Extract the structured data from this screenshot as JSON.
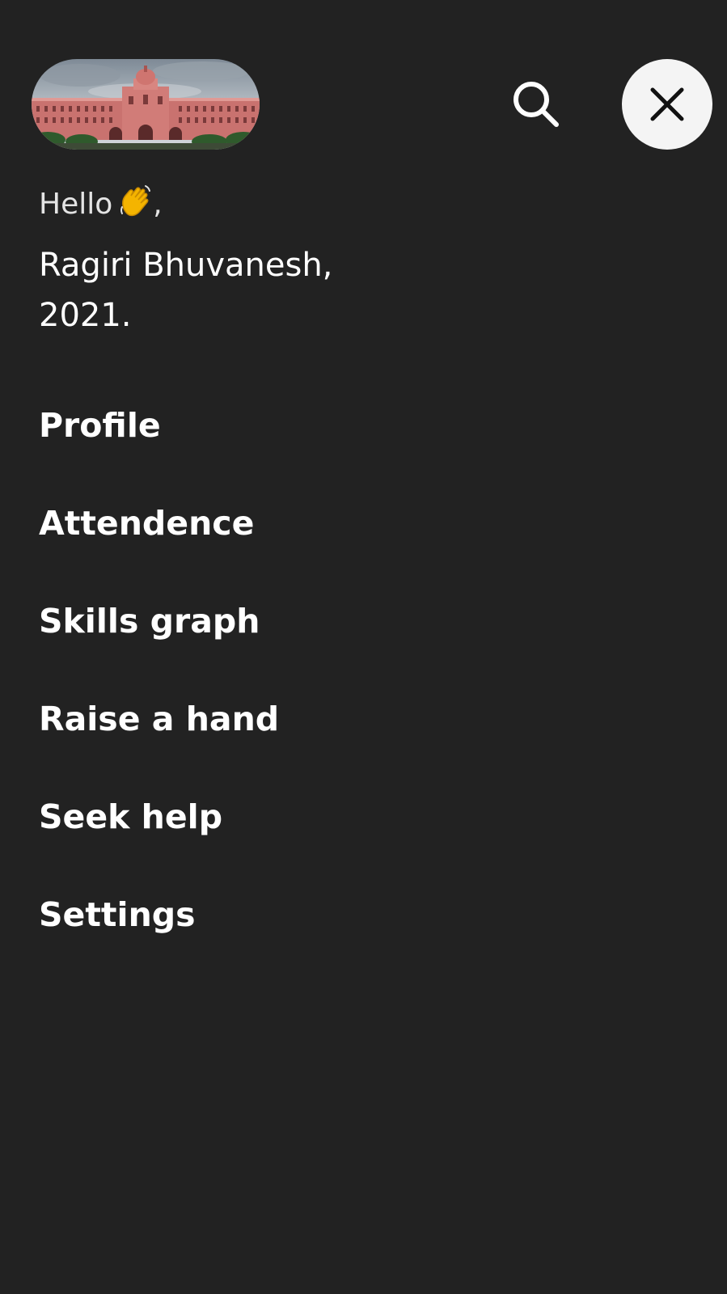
{
  "header": {
    "campus_image_alt": "campus building",
    "search_icon": "search-icon",
    "close_icon": "close-icon"
  },
  "greeting": {
    "hello": "Hello",
    "emoji": "waving-hand-icon",
    "comma": ","
  },
  "user": {
    "name": "Ragiri Bhuvanesh,",
    "year": "2021."
  },
  "menu": {
    "items": [
      {
        "label": "Profile"
      },
      {
        "label": "Attendence"
      },
      {
        "label": "Skills graph"
      },
      {
        "label": "Raise a hand"
      },
      {
        "label": "Seek help"
      },
      {
        "label": "Settings"
      }
    ]
  },
  "colors": {
    "background": "#222222",
    "text": "#ffffff",
    "close_button_bg": "#f4f4f4"
  }
}
